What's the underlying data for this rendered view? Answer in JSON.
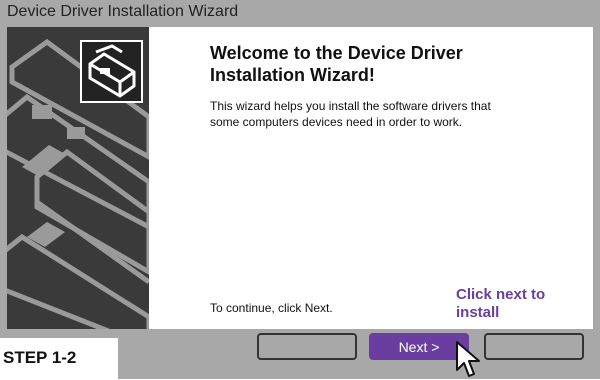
{
  "window": {
    "title": "Device Driver Installation Wizard"
  },
  "wizard": {
    "heading": "Welcome to the Device Driver Installation Wizard!",
    "description": "This wizard helps you install the software drivers that some computers devices need in order to work.",
    "continue_text": "To continue, click Next.",
    "logo_icon": "hardware-driver-icon"
  },
  "buttons": {
    "back_label": "",
    "next_label": "Next >",
    "cancel_label": ""
  },
  "annotation": {
    "hint": "Click next to install",
    "step": "STEP 1-2",
    "accent_color": "#6a3ea0"
  },
  "cursor_icon": "arrow-pointer-icon"
}
